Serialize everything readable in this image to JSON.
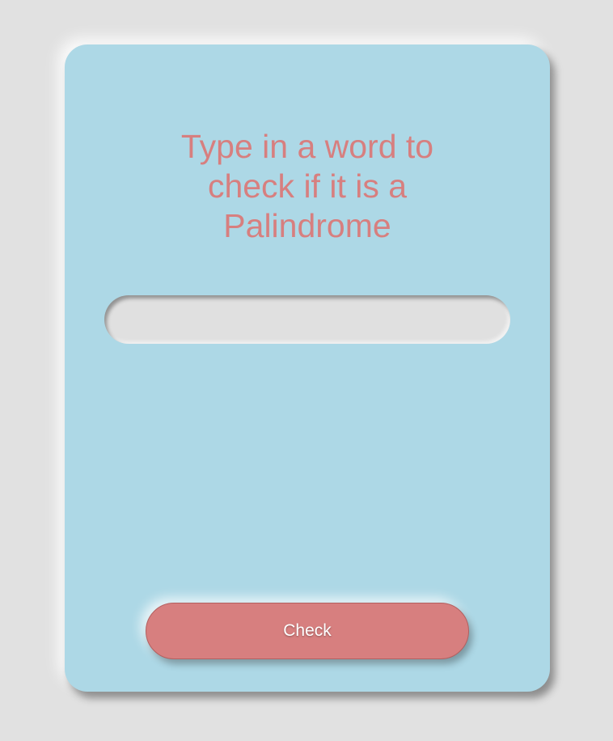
{
  "card": {
    "heading": "Type in a word to check if it is a Palindrome"
  },
  "word_input": {
    "value": "",
    "placeholder": ""
  },
  "check_button": {
    "label": "Check"
  },
  "colors": {
    "page_background": "#e1e1e1",
    "card_background": "#add8e6",
    "accent": "#d77f7f",
    "input_background": "#e0e0e0",
    "button_text": "#ffffff"
  }
}
